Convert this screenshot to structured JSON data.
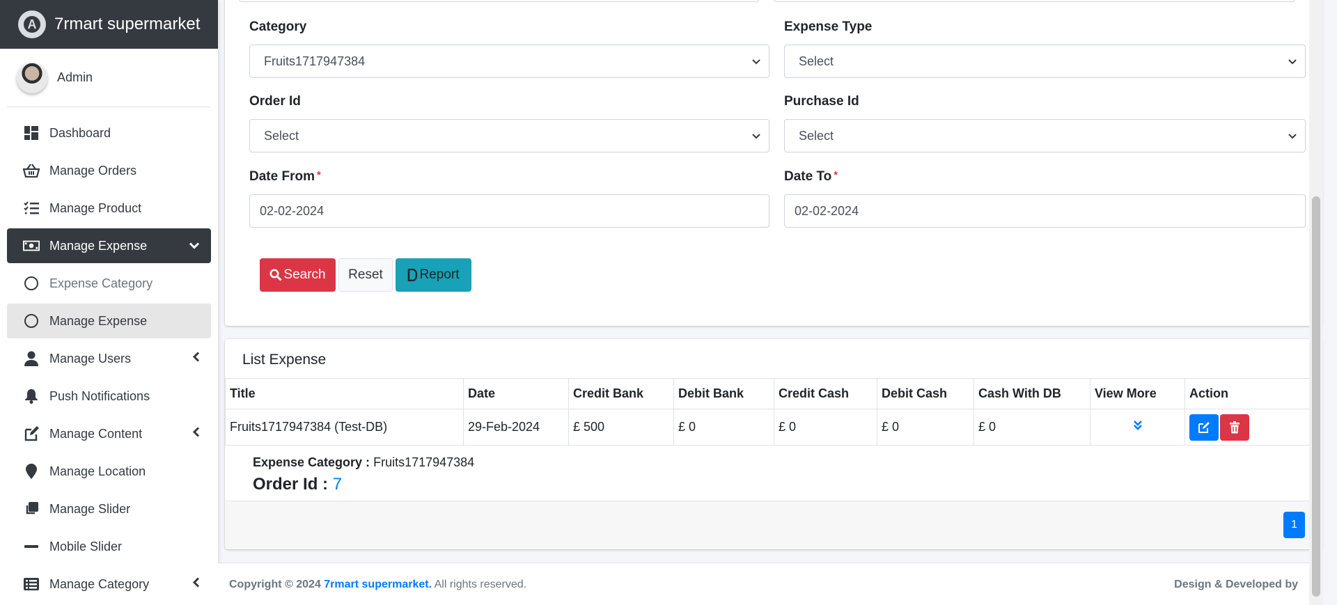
{
  "brand": {
    "name": "7rmart supermarket",
    "logo_letter": "A"
  },
  "user": {
    "name": "Admin"
  },
  "sidebar": {
    "items": [
      {
        "label": "Dashboard",
        "icon": "dashboard-icon"
      },
      {
        "label": "Manage Orders",
        "icon": "basket-icon"
      },
      {
        "label": "Manage Product",
        "icon": "tasks-icon"
      },
      {
        "label": "Manage Expense",
        "icon": "money-bill-icon",
        "active": true,
        "caret": "⌄"
      },
      {
        "label": "Expense Category",
        "icon": "circle-icon",
        "sub": true
      },
      {
        "label": "Manage Expense",
        "icon": "circle-icon",
        "sub": true,
        "current": true
      },
      {
        "label": "Manage Users",
        "icon": "user-icon",
        "caret": "‹"
      },
      {
        "label": "Push Notifications",
        "icon": "bell-icon"
      },
      {
        "label": "Manage Content",
        "icon": "edit-icon",
        "caret": "‹"
      },
      {
        "label": "Manage Location",
        "icon": "map-marker-icon"
      },
      {
        "label": "Manage Slider",
        "icon": "clone-icon"
      },
      {
        "label": "Mobile Slider",
        "icon": "minus-icon"
      },
      {
        "label": "Manage Category",
        "icon": "list-icon",
        "caret": "‹"
      }
    ]
  },
  "filters": {
    "category": {
      "label": "Category",
      "value": "Fruits1717947384"
    },
    "expense_type": {
      "label": "Expense Type",
      "value": "Select"
    },
    "order_id": {
      "label": "Order Id",
      "value": "Select"
    },
    "purchase_id": {
      "label": "Purchase Id",
      "value": "Select"
    },
    "date_from": {
      "label": "Date From",
      "value": "02-02-2024"
    },
    "date_to": {
      "label": "Date To",
      "value": "02-02-2024"
    },
    "required_mark": "*"
  },
  "buttons": {
    "search": "Search",
    "reset": "Reset",
    "report": "Report"
  },
  "list": {
    "title": "List Expense",
    "columns": [
      "Title",
      "Date",
      "Credit Bank",
      "Debit Bank",
      "Credit Cash",
      "Debit Cash",
      "Cash With DB",
      "View More",
      "Action"
    ],
    "rows": [
      [
        "Fruits1717947384 (Test-DB)",
        "29-Feb-2024",
        "£ 500",
        "£ 0",
        "£ 0",
        "£ 0",
        "£ 0"
      ]
    ],
    "detail": {
      "category_label": "Expense Category :",
      "category_value": "Fruits1717947384",
      "order_label": "Order Id :",
      "order_value": "7"
    },
    "page": "1"
  },
  "footer": {
    "copyright_prefix": "Copyright © 2024",
    "company": "7rmart supermarket.",
    "rights": "All rights reserved.",
    "right_text": "Design & Developed by"
  },
  "colors": {
    "danger": "#dc3545",
    "info": "#17a2b8",
    "primary": "#007bff",
    "dark": "#343a40"
  }
}
